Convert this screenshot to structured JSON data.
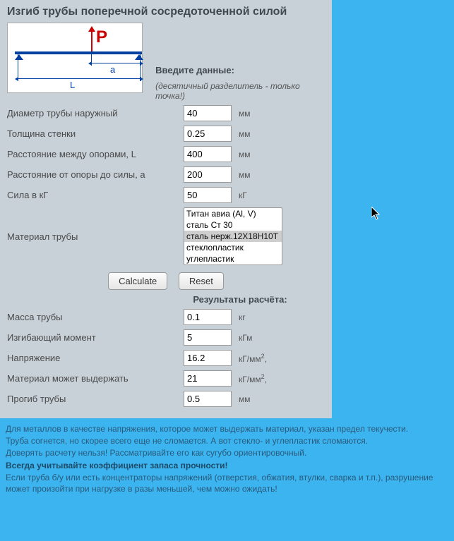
{
  "title": "Изгиб трубы поперечной сосредоточенной силой",
  "diagram": {
    "p": "P",
    "a": "a",
    "l": "L"
  },
  "intro": {
    "heading": "Введите данные:",
    "note": "(десятичный разделитель - только точка!)"
  },
  "inputs": {
    "diameter": {
      "label": "Диаметр трубы наружный",
      "value": "40",
      "unit": "мм"
    },
    "thickness": {
      "label": "Толщина стенки",
      "value": "0.25",
      "unit": "мм"
    },
    "span": {
      "label": "Расстояние между опорами, L",
      "value": "400",
      "unit": "мм"
    },
    "dist_a": {
      "label": "Расстояние от опоры до силы, а",
      "value": "200",
      "unit": "мм"
    },
    "force": {
      "label": "Сила в кГ",
      "value": "50",
      "unit": "кГ"
    },
    "material": {
      "label": "Материал трубы",
      "options": [
        "Титан авиа (Al, V)",
        "сталь Ст 30",
        "сталь нерж.12Х18Н10Т",
        "стеклопластик",
        "углепластик"
      ],
      "selected": "сталь нерж.12Х18Н10Т"
    }
  },
  "buttons": {
    "calculate": "Calculate",
    "reset": "Reset"
  },
  "results": {
    "heading": "Результаты расчёта:",
    "mass": {
      "label": "Масса трубы",
      "value": "0.1",
      "unit": "кг"
    },
    "moment": {
      "label": "Изгибающий момент",
      "value": "5",
      "unit": "кГм"
    },
    "stress": {
      "label": "Напряжение",
      "value": "16.2",
      "unit": "кГ/мм",
      "sup": "2",
      "suffix": ","
    },
    "capacity": {
      "label": "Материал может выдержать",
      "value": "21",
      "unit": "кГ/мм",
      "sup": "2",
      "suffix": ","
    },
    "deflection": {
      "label": "Прогиб трубы",
      "value": "0.5",
      "unit": "мм"
    }
  },
  "notes": {
    "l1": "Для металлов в качестве напряжения, которое может выдержать материал, указан предел текучести.",
    "l2": "Труба согнется, но скорее всего еще не сломается. А вот стекло- и углепластик сломаются.",
    "l3": "Доверять расчету нельзя! Рассматривайте его как сугубо ориентировочный.",
    "l4": "Всегда учитывайте коэффициент запаса прочности!",
    "l5": "Если труба б/у или есть концентраторы напряжений (отверстия, обжатия, втулки, сварка и т.п.), разрушение может произойти при нагрузке в разы меньшей, чем можно ожидать!"
  }
}
